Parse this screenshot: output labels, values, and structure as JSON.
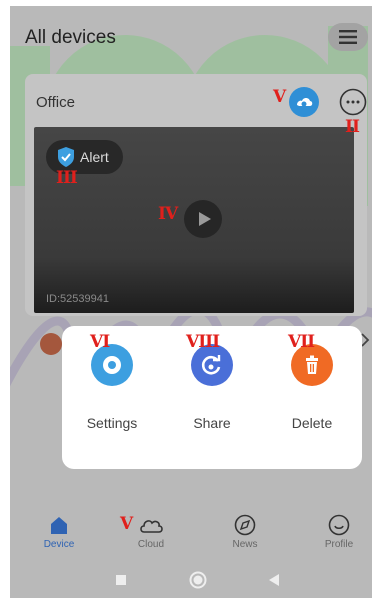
{
  "header": {
    "title": "All devices",
    "menu_icon": "hamburger-menu-icon"
  },
  "device": {
    "name": "Office",
    "alert_label": "Alert",
    "device_id": "ID:52539941",
    "cloud_icon": "cloud-status-icon",
    "more_icon": "more-options-icon"
  },
  "dialog": {
    "actions": [
      {
        "label": "Settings",
        "icon": "settings-icon",
        "color": "#3d9fe0"
      },
      {
        "label": "Share",
        "icon": "share-icon",
        "color": "#4a6fd8"
      },
      {
        "label": "Delete",
        "icon": "delete-icon",
        "color": "#f06a24"
      }
    ]
  },
  "tabs": [
    {
      "label": "Device",
      "icon": "home-icon",
      "active": true
    },
    {
      "label": "Cloud",
      "icon": "cloud-icon",
      "active": false
    },
    {
      "label": "News",
      "icon": "compass-icon",
      "active": false
    },
    {
      "label": "Profile",
      "icon": "profile-icon",
      "active": false
    }
  ],
  "annotations": {
    "cloud_badge": "V",
    "more_button": "II",
    "alert": "III",
    "play": "IV",
    "settings": "VI",
    "share": "VIII",
    "delete": "VII",
    "cloud_tab": "V"
  },
  "colors": {
    "accent": "#2f63b3",
    "annotation": "#e0201c",
    "alert_shield": "#3d9fe0"
  }
}
